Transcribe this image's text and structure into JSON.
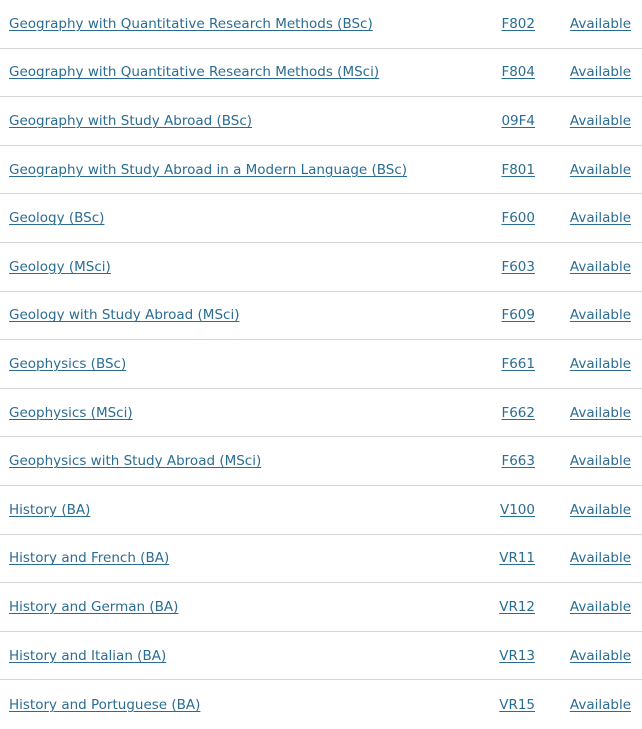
{
  "courses": [
    {
      "name": "Geography with Quantitative Research Methods (BSc)",
      "code": "F802",
      "status": "Available"
    },
    {
      "name": "Geography with Quantitative Research Methods (MSci)",
      "code": "F804",
      "status": "Available"
    },
    {
      "name": "Geography with Study Abroad (BSc)",
      "code": "09F4",
      "status": "Available"
    },
    {
      "name": "Geography with Study Abroad in a Modern Language (BSc)",
      "code": "F801",
      "status": "Available"
    },
    {
      "name": "Geology (BSc)",
      "code": "F600",
      "status": "Available"
    },
    {
      "name": "Geology (MSci)",
      "code": "F603",
      "status": "Available"
    },
    {
      "name": "Geology with Study Abroad (MSci)",
      "code": "F609",
      "status": "Available"
    },
    {
      "name": "Geophysics (BSc)",
      "code": "F661",
      "status": "Available"
    },
    {
      "name": "Geophysics (MSci)",
      "code": "F662",
      "status": "Available"
    },
    {
      "name": "Geophysics with Study Abroad (MSci)",
      "code": "F663",
      "status": "Available"
    },
    {
      "name": "History (BA)",
      "code": "V100",
      "status": "Available"
    },
    {
      "name": "History and French (BA)",
      "code": "VR11",
      "status": "Available"
    },
    {
      "name": "History and German (BA)",
      "code": "VR12",
      "status": "Available"
    },
    {
      "name": "History and Italian (BA)",
      "code": "VR13",
      "status": "Available"
    },
    {
      "name": "History and Portuguese (BA)",
      "code": "VR15",
      "status": "Available"
    }
  ],
  "colors": {
    "link": "#2a6d93",
    "divider": "#d5d5d5"
  }
}
